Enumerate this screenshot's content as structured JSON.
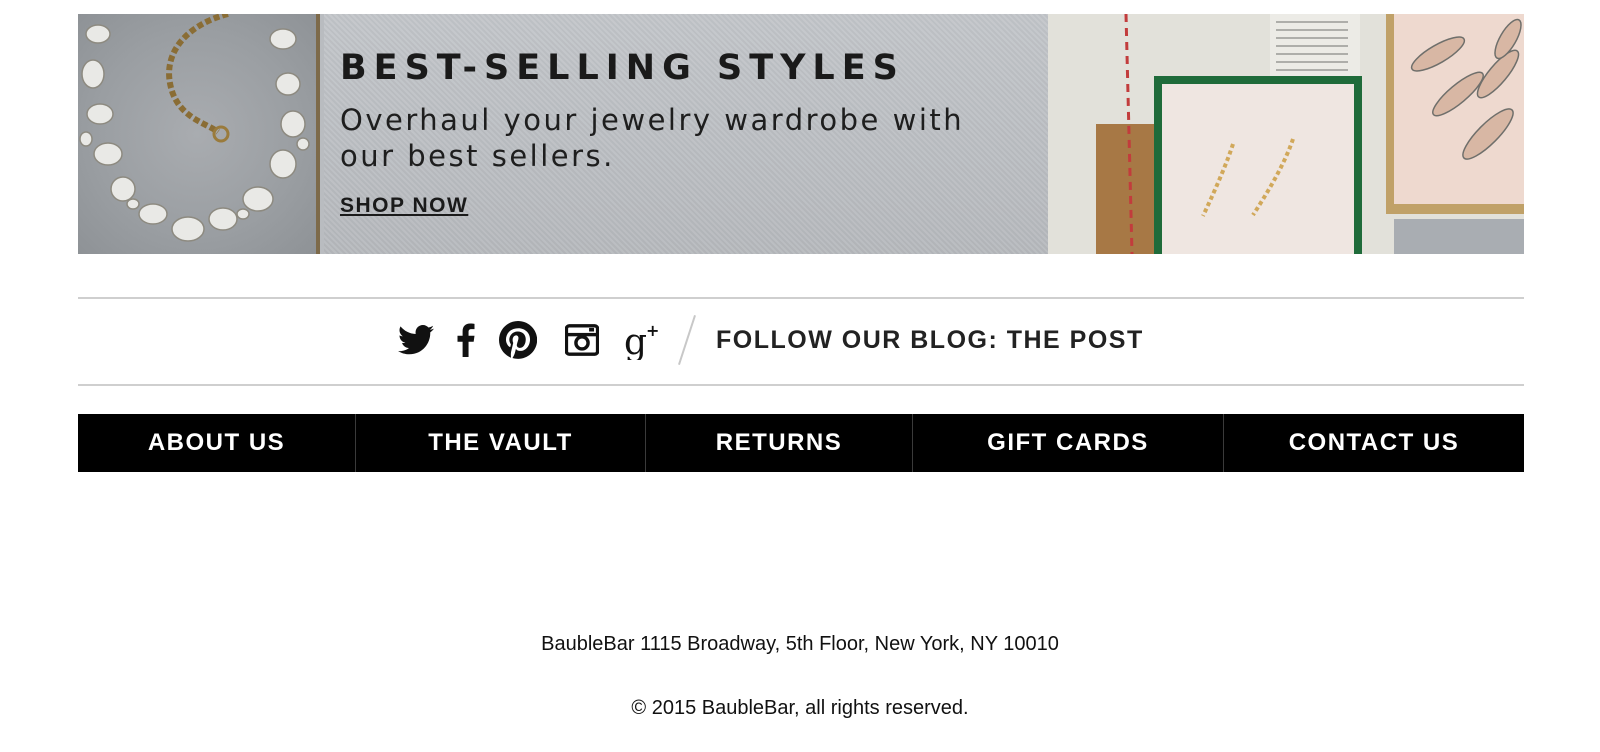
{
  "banner": {
    "title": "BEST-SELLING STYLES",
    "subtitle": "Overhaul your jewelry wardrobe with our best sellers.",
    "cta": "SHOP NOW"
  },
  "social": {
    "icons": [
      "twitter-icon",
      "facebook-icon",
      "pinterest-icon",
      "instagram-icon",
      "google-plus-icon"
    ],
    "blog_link": "FOLLOW OUR BLOG: THE POST"
  },
  "nav": {
    "items": [
      "ABOUT US",
      "THE VAULT",
      "RETURNS",
      "GIFT CARDS",
      "CONTACT US"
    ]
  },
  "footer": {
    "address": "BaubleBar 1115 Broadway, 5th Floor, New York, NY 10010",
    "copyright": "© 2015 BaubleBar, all rights reserved."
  },
  "colors": {
    "nav_background": "#000000",
    "nav_text": "#ffffff",
    "banner_gray": "#b9bcc0",
    "rule": "#cfcfcf"
  }
}
